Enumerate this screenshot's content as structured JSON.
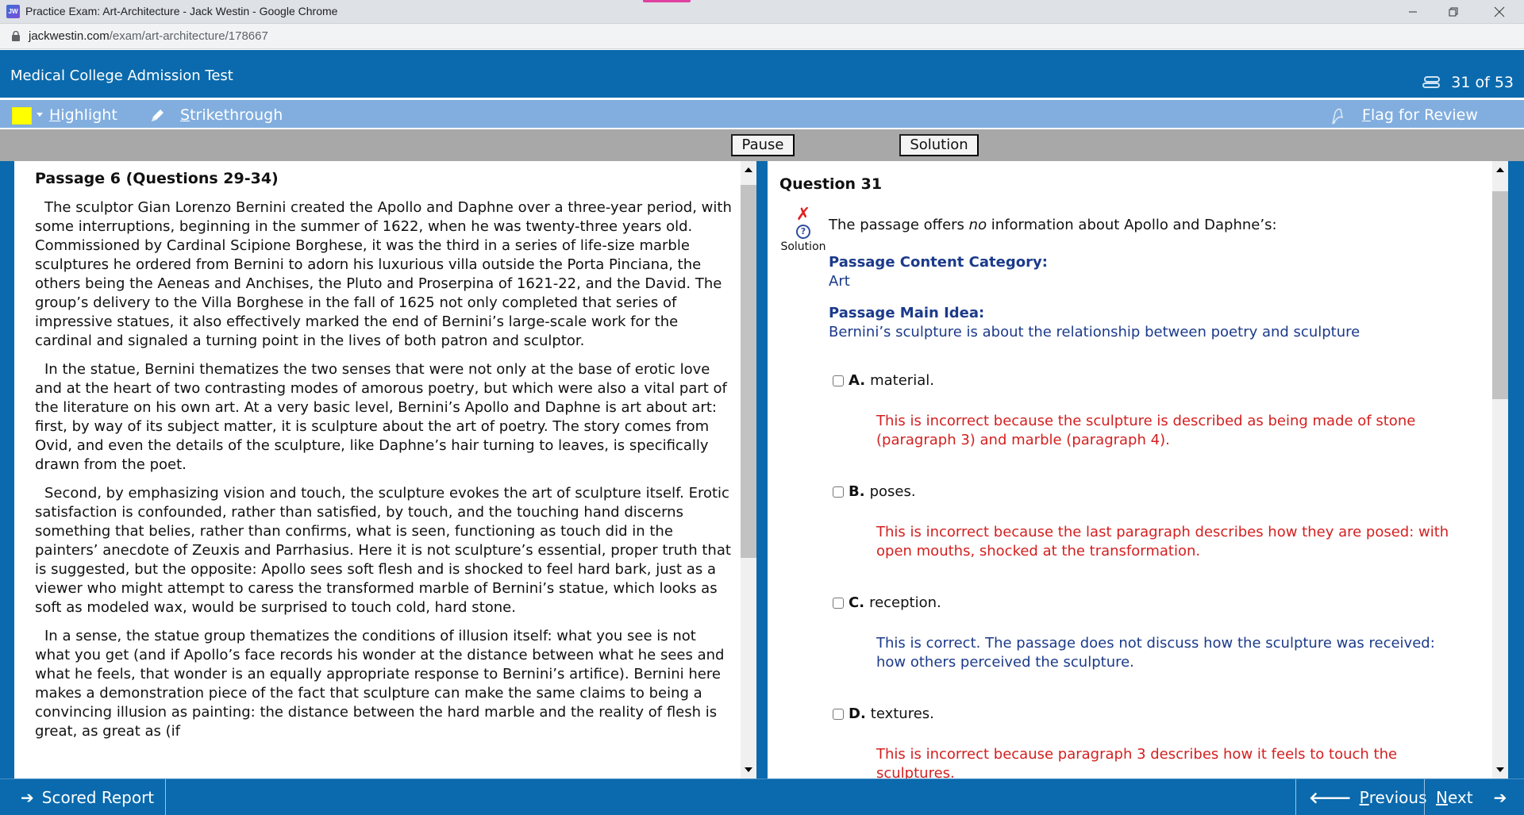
{
  "browser": {
    "window_title": "Practice Exam: Art-Architecture - Jack Westin - Google Chrome",
    "app_icon_text": "JW",
    "url_host": "jackwestin.com",
    "url_path": "/exam/art-architecture/178667"
  },
  "header": {
    "title": "Medical College Admission Test",
    "counter": "31 of 53"
  },
  "toolbar": {
    "highlight_color": "#ffff00",
    "highlight_first": "H",
    "highlight_rest": "ighlight",
    "strike_first": "S",
    "strike_rest": "trikethrough",
    "flag_first": "F",
    "flag_rest": "lag for Review"
  },
  "actions": {
    "pause": "Pause",
    "solution": "Solution"
  },
  "passage": {
    "title": "Passage 6 (Questions 29-34)",
    "paragraphs": [
      "The sculptor Gian Lorenzo Bernini created the Apollo and Daphne over a three-year period, with some interruptions, beginning in the summer of 1622, when he was twenty-three years old. Commissioned by Cardinal Scipione Borghese, it was the third in a series of life-size marble sculptures he ordered from Bernini to adorn his luxurious villa outside the Porta Pinciana, the others being the Aeneas and Anchises, the Pluto and Proserpina of 1621-22, and the David. The group’s delivery to the Villa Borghese in the fall of 1625 not only completed that series of impressive statues, it also effectively marked the end of Bernini’s large-scale work for the cardinal and signaled a turning point in the lives of both patron and sculptor.",
      "In the statue, Bernini thematizes the two senses that were not only at the base of erotic love and at the heart of two contrasting modes of amorous poetry, but which were also a vital part of the literature on his own art. At a very basic level, Bernini’s Apollo and Daphne is art about art: first, by way of its subject matter, it is sculpture about the art of poetry. The story comes from Ovid, and even the details of the sculpture, like Daphne’s hair turning to leaves, is specifically drawn from the poet.",
      "Second, by emphasizing vision and touch, the sculpture evokes the art of sculpture itself. Erotic satisfaction is confounded, rather than satisfied, by touch, and the touching hand discerns something that belies, rather than confirms, what is seen, functioning as touch did in the painters’ anecdote of Zeuxis and Parrhasius. Here it is not sculpture’s essential, proper truth that is suggested, but the opposite: Apollo sees soft flesh and is shocked to feel hard bark, just as a viewer who might attempt to caress the transformed marble of Bernini’s statue, which looks as soft as modeled wax, would be surprised to touch cold, hard stone.",
      "In a sense, the statue group thematizes the conditions of illusion itself: what you see is not what you get (and if Apollo’s face records his wonder at the distance between what he sees and what he feels, that wonder is an equally appropriate response to Bernini’s artifice). Bernini here makes a demonstration piece of the fact that sculpture can make the same claims to being a convincing illusion as painting: the distance between the hard marble and the reality of flesh is great, as great as (if"
    ]
  },
  "question": {
    "title": "Question 31",
    "status_icon": "incorrect-x",
    "solution_label": "Solution",
    "stem_before": "The passage offers ",
    "stem_emphasis": "no",
    "stem_after": " information about Apollo and Daphne’s:",
    "category_label": "Passage Content Category:",
    "category_value": "Art",
    "main_idea_label": "Passage Main Idea:",
    "main_idea_value": "Bernini’s sculpture is about the relationship between poetry and sculpture",
    "options": [
      {
        "letter": "A.",
        "text": "material.",
        "checked": false,
        "correct": false,
        "explanation": "This is incorrect because the sculpture is described as being made of stone (paragraph 3) and marble (paragraph 4)."
      },
      {
        "letter": "B.",
        "text": "poses.",
        "checked": false,
        "correct": false,
        "explanation": "This is incorrect because the last paragraph describes how they are posed: with open mouths, shocked at the transformation."
      },
      {
        "letter": "C.",
        "text": "reception.",
        "checked": false,
        "correct": true,
        "explanation": "This is correct. The passage does not discuss how the sculpture was received: how others perceived the sculpture."
      },
      {
        "letter": "D.",
        "text": "textures.",
        "checked": false,
        "correct": false,
        "explanation": "This is incorrect because paragraph 3 describes how it feels to touch the sculptures."
      }
    ]
  },
  "footer": {
    "scored_report": "Scored Report",
    "previous_first": "P",
    "previous_rest": "revious",
    "next_first": "N",
    "next_rest": "ext"
  },
  "colors": {
    "brand_blue": "#0a6aad",
    "toolbar_blue": "#81aedf",
    "incorrect_red": "#d42020",
    "correct_navy": "#1b3a8a"
  }
}
